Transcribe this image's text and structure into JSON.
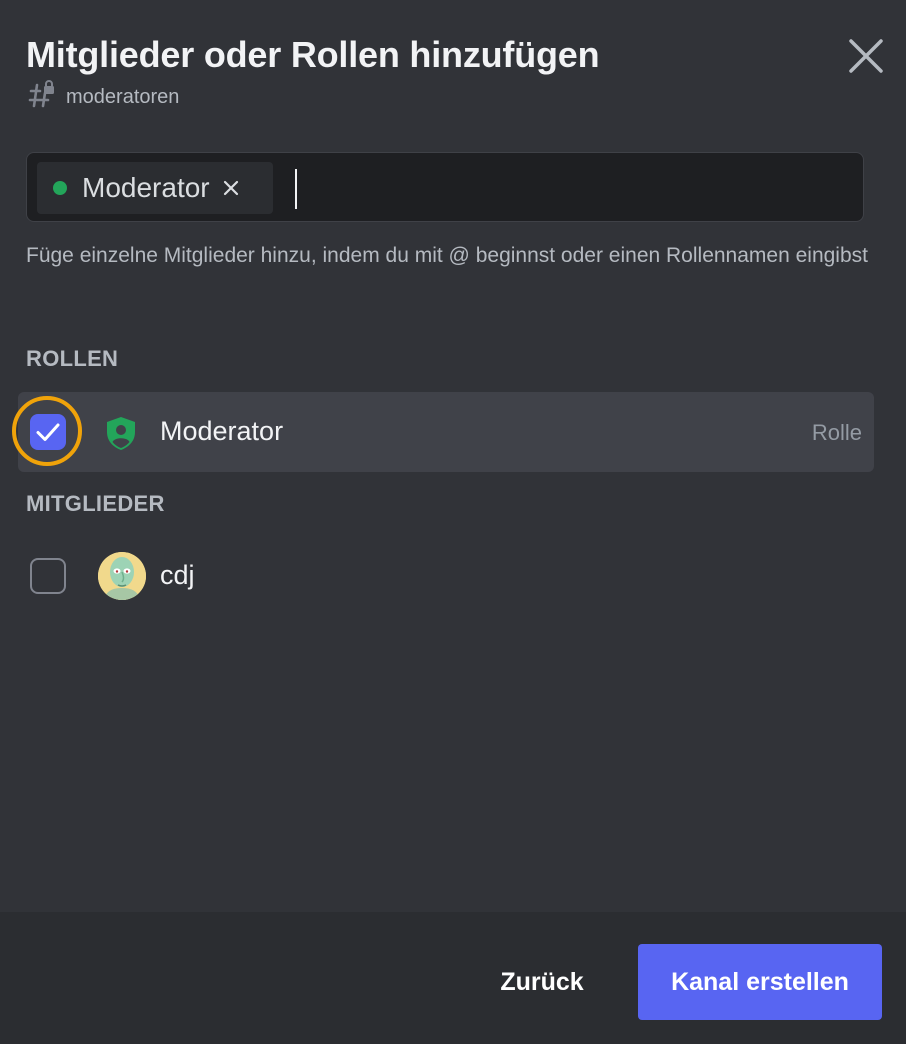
{
  "modal": {
    "title": "Mitglieder oder Rollen hinzufügen",
    "channel_name": "moderatoren",
    "channel_icon": "hash-lock-icon",
    "close_icon": "close-icon"
  },
  "search": {
    "chips": [
      {
        "label": "Moderator",
        "dot_color": "#23a55a",
        "remove_icon": "close-icon"
      }
    ],
    "value": "",
    "placeholder": ""
  },
  "hint": "Füge einzelne Mitglieder hinzu, indem du mit @ beginnst oder einen Rollennamen eingibst",
  "roles_section": {
    "label": "ROLLEN",
    "items": [
      {
        "name": "Moderator",
        "tag": "Rolle",
        "checked": true,
        "icon": "shield-user-icon",
        "icon_color": "#23a55a"
      }
    ]
  },
  "members_section": {
    "label": "MITGLIEDER",
    "items": [
      {
        "name": "cdj",
        "checked": false,
        "avatar": "user-avatar"
      }
    ]
  },
  "footer": {
    "back_label": "Zurück",
    "create_label": "Kanal erstellen"
  },
  "colors": {
    "background": "#313338",
    "footer": "#2b2d31",
    "accent": "#5865f2",
    "highlight": "#f0a30a"
  }
}
